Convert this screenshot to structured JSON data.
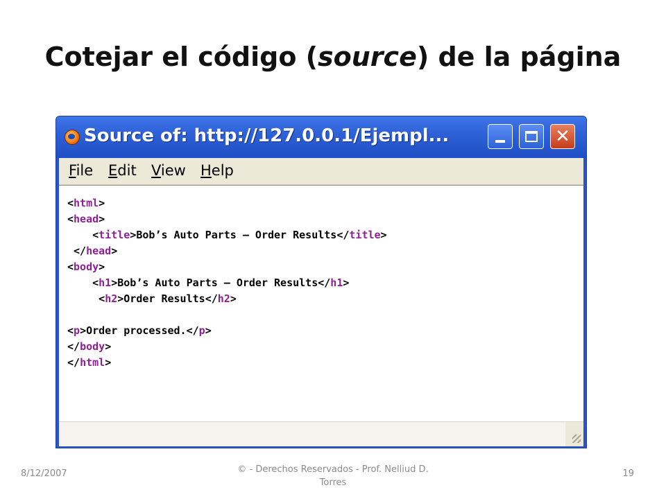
{
  "slide": {
    "title_prefix": "Cotejar el código (",
    "title_emphasis": "source",
    "title_suffix": ") de la página"
  },
  "window": {
    "title": "Source of: http://127.0.0.1/Ejempl...",
    "minimize_icon": "minimize-icon",
    "maximize_icon": "maximize-icon",
    "close_icon": "close-icon",
    "app_icon": "firefox-icon"
  },
  "menu": {
    "items": [
      {
        "accel": "F",
        "rest": "ile"
      },
      {
        "accel": "E",
        "rest": "dit"
      },
      {
        "accel": "V",
        "rest": "iew"
      },
      {
        "accel": "H",
        "rest": "elp"
      }
    ]
  },
  "source": {
    "lines": [
      "<html>",
      "<head>",
      "    <title>Bob’s Auto Parts – Order Results</title>",
      " </head>",
      "<body>",
      "    <h1>Bob’s Auto Parts – Order Results</h1>",
      "     <h2>Order Results</h2>",
      "",
      "<p>Order processed.</p>",
      "</body>",
      "</html>"
    ]
  },
  "footer": {
    "date": "8/12/2007",
    "copyright": "© - Derechos Reservados - Prof. Nelliud D. Torres",
    "page_number": "19"
  },
  "colors": {
    "titlebar": "#2d5fd6",
    "close_button": "#c63c1c",
    "tag_color": "#8e1f96",
    "menubar": "#ece9d8"
  }
}
